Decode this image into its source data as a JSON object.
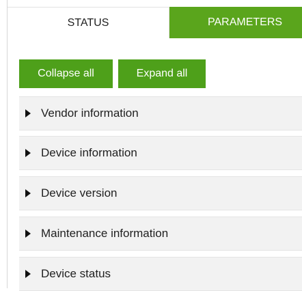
{
  "tabs": {
    "status": "STATUS",
    "parameters": "PARAMETERS"
  },
  "toolbar": {
    "collapse_all": "Collapse all",
    "expand_all": "Expand all"
  },
  "sections": [
    {
      "label": "Vendor information",
      "state": "collapsed"
    },
    {
      "label": "Device information",
      "state": "collapsed"
    },
    {
      "label": "Device version",
      "state": "collapsed"
    },
    {
      "label": "Maintenance information",
      "state": "collapsed"
    },
    {
      "label": "Device status",
      "state": "collapsed"
    }
  ],
  "theme": {
    "accent": "#5aa51c",
    "section_bg": "#f2f2f2",
    "caret_icon": "caret-right-icon"
  }
}
